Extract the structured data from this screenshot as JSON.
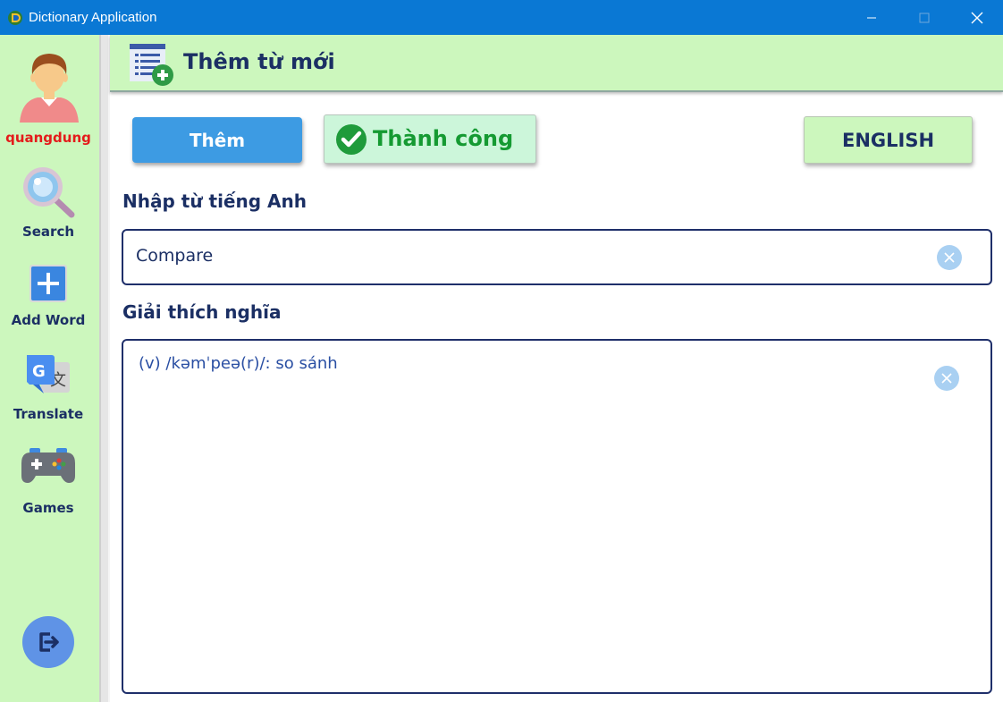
{
  "window": {
    "title": "Dictionary Application"
  },
  "sidebar": {
    "username": "quangdung",
    "items": [
      {
        "label": "Search",
        "icon": "search-icon"
      },
      {
        "label": "Add Word",
        "icon": "add-icon"
      },
      {
        "label": "Translate",
        "icon": "translate-icon"
      },
      {
        "label": "Games",
        "icon": "gamepad-icon"
      }
    ],
    "logout_icon": "logout-icon"
  },
  "header": {
    "title": "Thêm từ mới",
    "icon": "add-word-list-icon"
  },
  "toolbar": {
    "add_label": "Thêm",
    "status_text": "Thành công",
    "language_label": "ENGLISH"
  },
  "form": {
    "word_label": "Nhập từ tiếng Anh",
    "word_value": "Compare",
    "meaning_label": "Giải thích nghĩa",
    "meaning_value": "(v) /kəmˈpeə(r)/: so sánh"
  },
  "colors": {
    "titlebar": "#0a78d4",
    "sidebar_bg": "#ccf7bd",
    "accent_blue": "#3d9be3",
    "navy_text": "#1b2f64",
    "success_green": "#159a32",
    "username_red": "#e41b1b"
  }
}
